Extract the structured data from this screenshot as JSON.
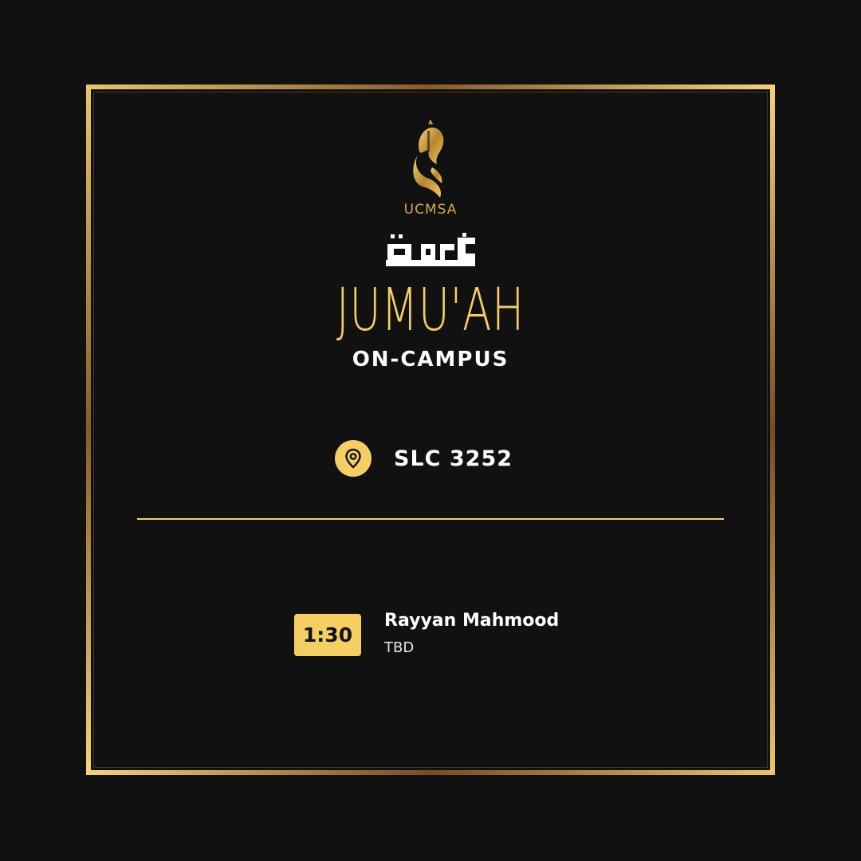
{
  "logo": {
    "icon": "ucsa-emblem-icon",
    "text": "UCMSA"
  },
  "arabic_title": {
    "icon": "arabic-calligraphy-jumuah-icon",
    "text": "جمعة"
  },
  "title": "JUMU'AH",
  "subtitle": "ON-CAMPUS",
  "location": {
    "icon": "map-pin-icon",
    "text": "SLC 3252"
  },
  "schedule": [
    {
      "time": "1:30",
      "speaker": "Rayyan Mahmood",
      "topic": "TBD"
    }
  ],
  "colors": {
    "background": "#111111",
    "accent": "#f6cf63",
    "frame": "#c9a14a",
    "text": "#ffffff"
  }
}
